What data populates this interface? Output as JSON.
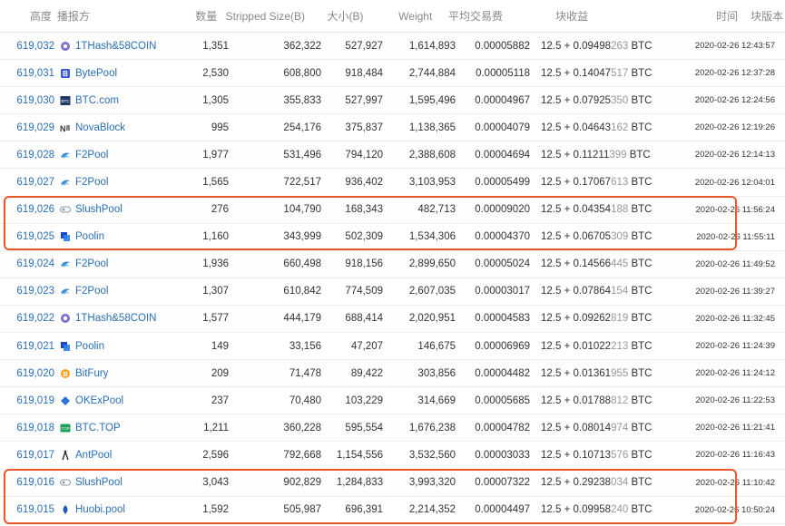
{
  "headers": {
    "height": "高度",
    "pool": "播报方",
    "tx_count": "数量",
    "stripped_size": "Stripped Size(B)",
    "size": "大小(B)",
    "weight": "Weight",
    "avg_fee": "平均交易费",
    "reward": "块收益",
    "time": "时间",
    "version": "块版本"
  },
  "rows": [
    {
      "height": "619,032",
      "pool": "1THash&58COIN",
      "icon": "1thash-icon",
      "tx": "1,351",
      "stripped": "362,322",
      "size": "527,927",
      "weight": "1,614,893",
      "fee": "0.00005882",
      "reward_a": "12.5 + 0.09498",
      "reward_b": "263",
      "reward_unit": " BTC",
      "time": "2020-02-26 12:43:57"
    },
    {
      "height": "619,031",
      "pool": "BytePool",
      "icon": "bytepool-icon",
      "tx": "2,530",
      "stripped": "608,800",
      "size": "918,484",
      "weight": "2,744,884",
      "fee": "0.00005118",
      "reward_a": "12.5 + 0.14047",
      "reward_b": "517",
      "reward_unit": " BTC",
      "time": "2020-02-26 12:37:28"
    },
    {
      "height": "619,030",
      "pool": "BTC.com",
      "icon": "btccom-icon",
      "tx": "1,305",
      "stripped": "355,833",
      "size": "527,997",
      "weight": "1,595,496",
      "fee": "0.00004967",
      "reward_a": "12.5 + 0.07925",
      "reward_b": "350",
      "reward_unit": " BTC",
      "time": "2020-02-26 12:24:56"
    },
    {
      "height": "619,029",
      "pool": "NovaBlock",
      "icon": "novablock-icon",
      "tx": "995",
      "stripped": "254,176",
      "size": "375,837",
      "weight": "1,138,365",
      "fee": "0.00004079",
      "reward_a": "12.5 + 0.04643",
      "reward_b": "162",
      "reward_unit": " BTC",
      "time": "2020-02-26 12:19:26"
    },
    {
      "height": "619,028",
      "pool": "F2Pool",
      "icon": "f2pool-icon",
      "tx": "1,977",
      "stripped": "531,496",
      "size": "794,120",
      "weight": "2,388,608",
      "fee": "0.00004694",
      "reward_a": "12.5 + 0.11211",
      "reward_b": "399",
      "reward_unit": " BTC",
      "time": "2020-02-26 12:14:13"
    },
    {
      "height": "619,027",
      "pool": "F2Pool",
      "icon": "f2pool-icon",
      "tx": "1,565",
      "stripped": "722,517",
      "size": "936,402",
      "weight": "3,103,953",
      "fee": "0.00005499",
      "reward_a": "12.5 + 0.17067",
      "reward_b": "613",
      "reward_unit": " BTC",
      "time": "2020-02-26 12:04:01"
    },
    {
      "height": "619,026",
      "pool": "SlushPool",
      "icon": "slushpool-icon",
      "tx": "276",
      "stripped": "104,790",
      "size": "168,343",
      "weight": "482,713",
      "fee": "0.00009020",
      "reward_a": "12.5 + 0.04354",
      "reward_b": "188",
      "reward_unit": " BTC",
      "time": "2020-02-26 11:56:24"
    },
    {
      "height": "619,025",
      "pool": "Poolin",
      "icon": "poolin-icon",
      "tx": "1,160",
      "stripped": "343,999",
      "size": "502,309",
      "weight": "1,534,306",
      "fee": "0.00004370",
      "reward_a": "12.5 + 0.06705",
      "reward_b": "309",
      "reward_unit": " BTC",
      "time": "2020-02-26 11:55:11"
    },
    {
      "height": "619,024",
      "pool": "F2Pool",
      "icon": "f2pool-icon",
      "tx": "1,936",
      "stripped": "660,498",
      "size": "918,156",
      "weight": "2,899,650",
      "fee": "0.00005024",
      "reward_a": "12.5 + 0.14566",
      "reward_b": "445",
      "reward_unit": " BTC",
      "time": "2020-02-26 11:49:52"
    },
    {
      "height": "619,023",
      "pool": "F2Pool",
      "icon": "f2pool-icon",
      "tx": "1,307",
      "stripped": "610,842",
      "size": "774,509",
      "weight": "2,607,035",
      "fee": "0.00003017",
      "reward_a": "12.5 + 0.07864",
      "reward_b": "154",
      "reward_unit": " BTC",
      "time": "2020-02-26 11:39:27"
    },
    {
      "height": "619,022",
      "pool": "1THash&58COIN",
      "icon": "1thash-icon",
      "tx": "1,577",
      "stripped": "444,179",
      "size": "688,414",
      "weight": "2,020,951",
      "fee": "0.00004583",
      "reward_a": "12.5 + 0.09262",
      "reward_b": "819",
      "reward_unit": " BTC",
      "time": "2020-02-26 11:32:45"
    },
    {
      "height": "619,021",
      "pool": "Poolin",
      "icon": "poolin-icon",
      "tx": "149",
      "stripped": "33,156",
      "size": "47,207",
      "weight": "146,675",
      "fee": "0.00006969",
      "reward_a": "12.5 + 0.01022",
      "reward_b": "213",
      "reward_unit": " BTC",
      "time": "2020-02-26 11:24:39"
    },
    {
      "height": "619,020",
      "pool": "BitFury",
      "icon": "bitfury-icon",
      "tx": "209",
      "stripped": "71,478",
      "size": "89,422",
      "weight": "303,856",
      "fee": "0.00004482",
      "reward_a": "12.5 + 0.01361",
      "reward_b": "955",
      "reward_unit": " BTC",
      "time": "2020-02-26 11:24:12"
    },
    {
      "height": "619,019",
      "pool": "OKExPool",
      "icon": "okexpool-icon",
      "tx": "237",
      "stripped": "70,480",
      "size": "103,229",
      "weight": "314,669",
      "fee": "0.00005685",
      "reward_a": "12.5 + 0.01788",
      "reward_b": "812",
      "reward_unit": " BTC",
      "time": "2020-02-26 11:22:53"
    },
    {
      "height": "619,018",
      "pool": "BTC.TOP",
      "icon": "btctop-icon",
      "tx": "1,211",
      "stripped": "360,228",
      "size": "595,554",
      "weight": "1,676,238",
      "fee": "0.00004782",
      "reward_a": "12.5 + 0.08014",
      "reward_b": "974",
      "reward_unit": " BTC",
      "time": "2020-02-26 11:21:41"
    },
    {
      "height": "619,017",
      "pool": "AntPool",
      "icon": "antpool-icon",
      "tx": "2,596",
      "stripped": "792,668",
      "size": "1,154,556",
      "weight": "3,532,560",
      "fee": "0.00003033",
      "reward_a": "12.5 + 0.10713",
      "reward_b": "576",
      "reward_unit": " BTC",
      "time": "2020-02-26 11:16:43"
    },
    {
      "height": "619,016",
      "pool": "SlushPool",
      "icon": "slushpool-icon",
      "tx": "3,043",
      "stripped": "902,829",
      "size": "1,284,833",
      "weight": "3,993,320",
      "fee": "0.00007322",
      "reward_a": "12.5 + 0.29238",
      "reward_b": "034",
      "reward_unit": " BTC",
      "time": "2020-02-26 11:10:42"
    },
    {
      "height": "619,015",
      "pool": "Huobi.pool",
      "icon": "huobipool-icon",
      "tx": "1,592",
      "stripped": "505,987",
      "size": "696,391",
      "weight": "2,214,352",
      "fee": "0.00004497",
      "reward_a": "12.5 + 0.09958",
      "reward_b": "240",
      "reward_unit": " BTC",
      "time": "2020-02-26 10:50:24"
    }
  ],
  "colors": {
    "link": "#2b6fb3",
    "highlight": "#e8562a"
  }
}
